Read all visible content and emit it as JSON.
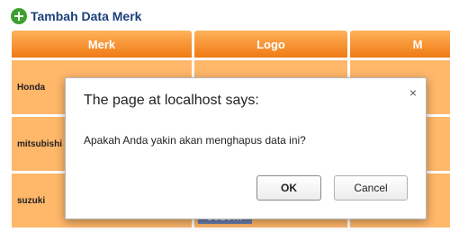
{
  "toolbar": {
    "add_label": "Tambah Data Merk"
  },
  "table": {
    "headers": [
      "Merk",
      "Logo",
      "M"
    ],
    "rows": [
      {
        "merk": "Honda"
      },
      {
        "merk": "mitsubishi"
      },
      {
        "merk": "suzuki",
        "logo_text": "SUZUKI"
      }
    ]
  },
  "dialog": {
    "title": "The page at localhost says:",
    "message": "Apakah Anda yakin akan menghapus data ini?",
    "close": "×",
    "ok_label": "OK",
    "cancel_label": "Cancel"
  },
  "colors": {
    "header_orange": "#f07a14",
    "row_orange": "#ffb76a",
    "link_blue": "#1b3f7a",
    "add_green": "#3c9f2f"
  },
  "icons": {
    "add": "plus-circle-icon"
  }
}
